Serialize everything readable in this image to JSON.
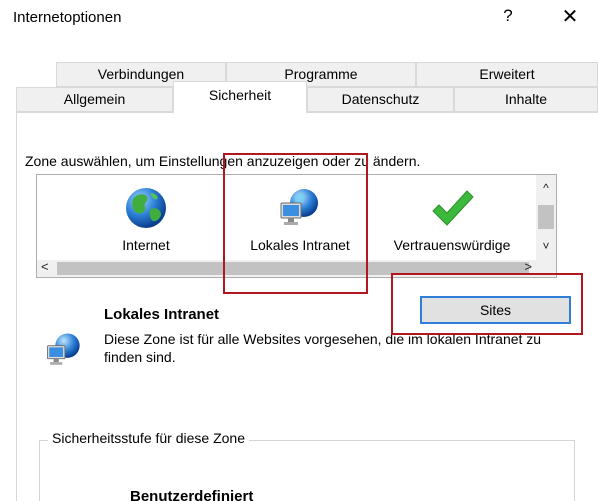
{
  "window": {
    "title": "Internetoptionen",
    "help_symbol": "?",
    "close_symbol": "✕"
  },
  "tabs": {
    "row_back": [
      {
        "label": "Verbindungen"
      },
      {
        "label": "Programme"
      },
      {
        "label": "Erweitert"
      }
    ],
    "row_front": [
      {
        "label": "Allgemein"
      },
      {
        "label": "Sicherheit"
      },
      {
        "label": "Datenschutz"
      },
      {
        "label": "Inhalte"
      }
    ],
    "active": "Sicherheit"
  },
  "security": {
    "instruction": "Zone auswählen, um Einstellungen anzuzeigen oder zu ändern.",
    "zones": [
      {
        "label": "Internet",
        "icon": "globe-icon"
      },
      {
        "label": "Lokales Intranet",
        "icon": "intranet-icon",
        "selected": true
      },
      {
        "label": "Vertrauenswürdige",
        "icon": "checkmark-icon"
      }
    ],
    "zone_heading": "Lokales Intranet",
    "zone_description": "Diese Zone ist für alle Websites vorgesehen, die im lokalen Intranet zu finden sind.",
    "sites_button": "Sites",
    "group_label": "Sicherheitsstufe für diese Zone",
    "level_label": "Benutzerdefiniert"
  },
  "scroll": {
    "up": "^",
    "down": "˅",
    "left": "<",
    "right": ">"
  },
  "colors": {
    "highlight": "#b0171f",
    "focus_border": "#2f7ed8",
    "tab_bg": "#f0f0f0"
  }
}
